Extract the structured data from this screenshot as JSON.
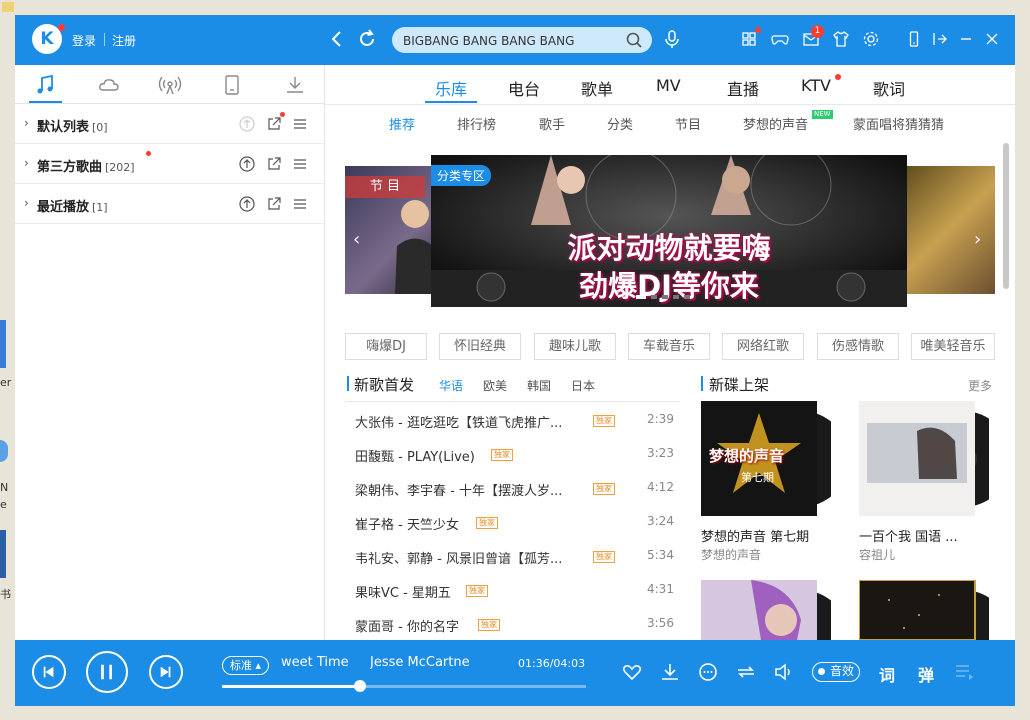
{
  "topbar": {
    "logo": "K",
    "login": "登录",
    "register": "注册",
    "search_value": "BIGBANG BANG BANG BANG",
    "notification_count": "1"
  },
  "sidebar": {
    "playlists": [
      {
        "name": "默认列表",
        "count": "[0]"
      },
      {
        "name": "第三方歌曲",
        "count": "[202]"
      },
      {
        "name": "最近播放",
        "count": "[1]"
      }
    ]
  },
  "main_tabs": [
    "乐库",
    "电台",
    "歌单",
    "MV",
    "直播",
    "KTV",
    "歌词"
  ],
  "sub_tabs": [
    "推荐",
    "排行榜",
    "歌手",
    "分类",
    "节目",
    "梦想的声音",
    "蒙面唱将猜猜猜"
  ],
  "new_badge": "NEW",
  "banner": {
    "tag": "分类专区",
    "line1": "派对动物就要嗨",
    "line2": "劲爆DJ等你来",
    "left_label": "节 目"
  },
  "categories": [
    "嗨爆DJ",
    "怀旧经典",
    "趣味儿歌",
    "车载音乐",
    "网络红歌",
    "伤感情歌",
    "唯美轻音乐"
  ],
  "new_songs": {
    "title": "新歌首发",
    "tabs": [
      "华语",
      "欧美",
      "韩国",
      "日本"
    ],
    "tag": "独家",
    "items": [
      {
        "title": "大张伟 - 逛吃逛吃【铁道飞虎推广...",
        "time": "2:39"
      },
      {
        "title": "田馥甄 - PLAY(Live)",
        "time": "3:23"
      },
      {
        "title": "梁朝伟、李宇春 - 十年【摆渡人岁...",
        "time": "4:12"
      },
      {
        "title": "崔子格 - 天竺少女",
        "time": "3:24"
      },
      {
        "title": "韦礼安、郭静 - 风景旧曾谙【孤芳...",
        "time": "5:34"
      },
      {
        "title": "果味VC - 星期五",
        "time": "4:31"
      },
      {
        "title": "蒙面哥 - 你的名字",
        "time": "3:56"
      }
    ]
  },
  "new_albums": {
    "title": "新碟上架",
    "more": "更多",
    "items": [
      {
        "title": "梦想的声音 第七期",
        "artist": "梦想的声音",
        "cover_text": "梦想的声音",
        "cover_sub": "第七期"
      },
      {
        "title": "一百个我 国语 ...",
        "artist": "容祖儿"
      }
    ]
  },
  "player": {
    "quality": "标准",
    "song": "weet Time",
    "artist": "Jesse McCartne",
    "time": "01:36/04:03",
    "progress": 0.38,
    "sound_effect": "音效",
    "lyrics": "词",
    "danmu": "弹"
  },
  "desktop": {
    "labels": [
      "er",
      "N",
      "e",
      "书"
    ]
  },
  "colors": {
    "primary": "#1c8de6",
    "red_dot": "#ff3b30",
    "tag_orange": "#e68a1c"
  }
}
